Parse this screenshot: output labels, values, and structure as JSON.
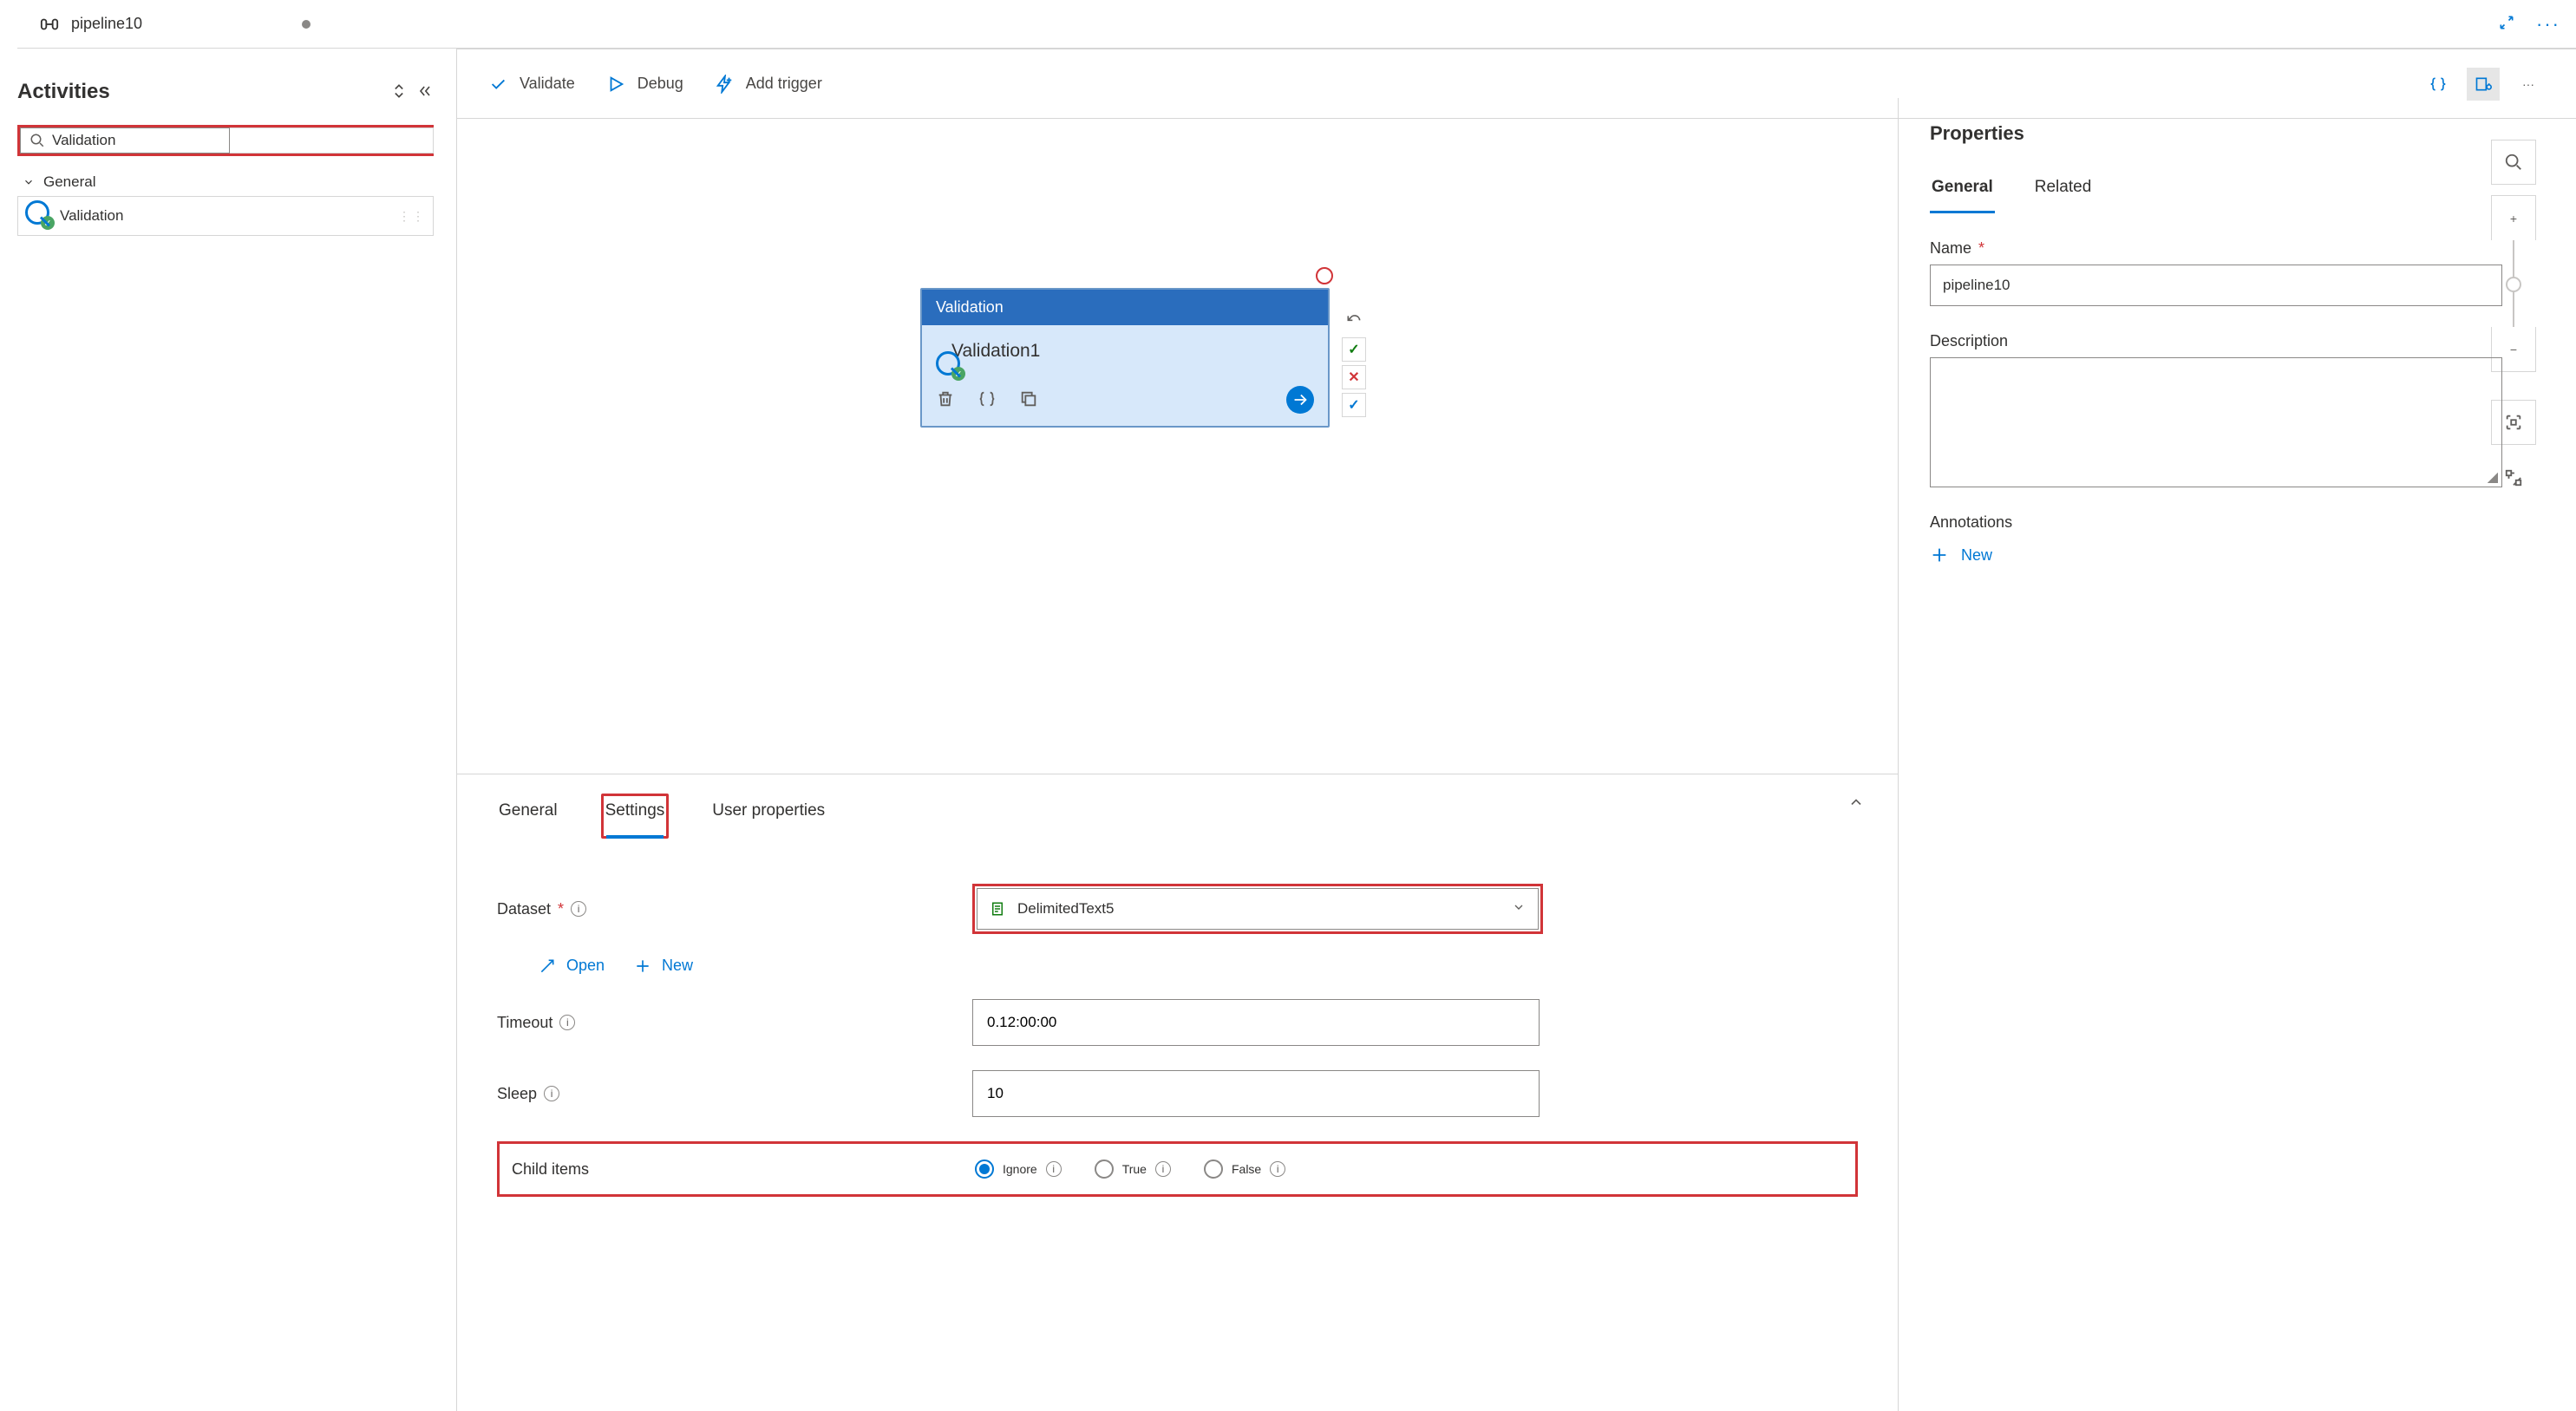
{
  "tab": {
    "title": "pipeline10"
  },
  "sidebar": {
    "title": "Activities",
    "search_value": "Validation",
    "group": "General",
    "item_label": "Validation"
  },
  "toolbar": {
    "validate": "Validate",
    "debug": "Debug",
    "add_trigger": "Add trigger"
  },
  "node": {
    "type": "Validation",
    "name": "Validation1"
  },
  "bottom": {
    "tabs": {
      "general": "General",
      "settings": "Settings",
      "user_props": "User properties"
    },
    "dataset_label": "Dataset",
    "dataset_value": "DelimitedText5",
    "open": "Open",
    "new": "New",
    "timeout_label": "Timeout",
    "timeout_value": "0.12:00:00",
    "sleep_label": "Sleep",
    "sleep_value": "10",
    "child_items_label": "Child items",
    "radio": {
      "ignore": "Ignore",
      "true": "True",
      "false": "False"
    }
  },
  "props": {
    "title": "Properties",
    "tabs": {
      "general": "General",
      "related": "Related"
    },
    "name_label": "Name",
    "name_value": "pipeline10",
    "desc_label": "Description",
    "annotations_label": "Annotations",
    "new": "New"
  }
}
